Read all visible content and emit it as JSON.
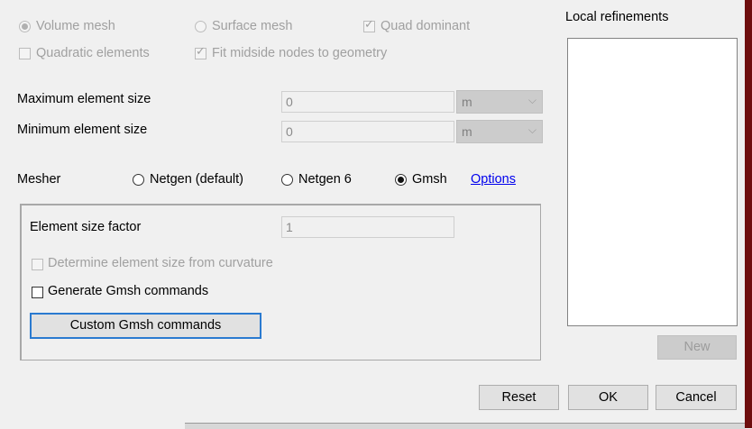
{
  "mesh_type": {
    "volume_label": "Volume mesh",
    "surface_label": "Surface mesh",
    "quad_label": "Quad dominant",
    "quadratic_label": "Quadratic elements",
    "fit_midside_label": "Fit midside nodes to geometry"
  },
  "sizes": {
    "max_label": "Maximum element size",
    "max_value": "0",
    "max_unit": "m",
    "min_label": "Minimum element size",
    "min_value": "0",
    "min_unit": "m"
  },
  "mesher": {
    "label": "Mesher",
    "option1": "Netgen (default)",
    "option2": "Netgen 6",
    "option3": "Gmsh",
    "options_link": "Options"
  },
  "gmsh": {
    "size_factor_label": "Element size factor",
    "size_factor_value": "1",
    "curvature_label": "Determine element size from curvature",
    "generate_label": "Generate Gmsh commands",
    "custom_button": "Custom Gmsh commands"
  },
  "refinements": {
    "title": "Local refinements",
    "new_button": "New"
  },
  "footer": {
    "reset": "Reset",
    "ok": "OK",
    "cancel": "Cancel"
  },
  "icons": {
    "dropdown": "chevron-down-icon",
    "check": "checkmark-icon"
  }
}
